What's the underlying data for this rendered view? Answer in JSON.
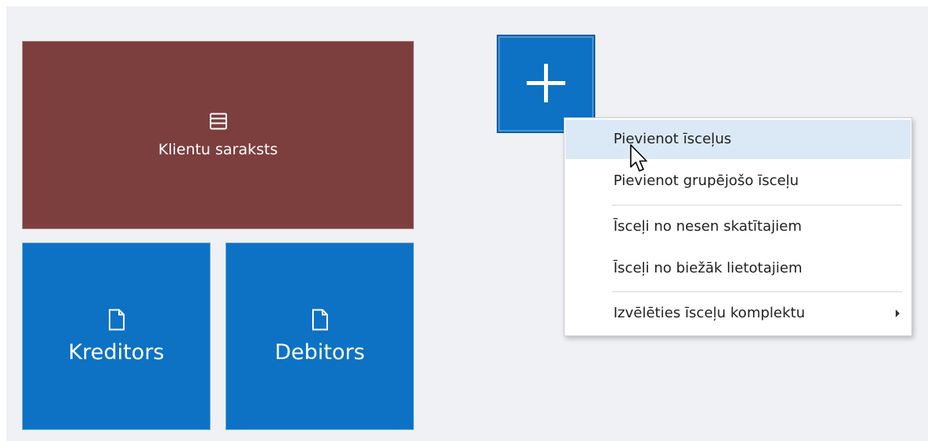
{
  "tiles": {
    "clients": {
      "label": "Klientu saraksts",
      "icon": "archive-box-icon"
    },
    "creditors": {
      "label": "Kreditors",
      "icon": "document-icon"
    },
    "debtors": {
      "label": "Debitors",
      "icon": "document-icon"
    },
    "add": {
      "icon": "plus-icon"
    }
  },
  "colors": {
    "background": "#eff1f4",
    "clients_tile": "#7d3e3e",
    "blue_tile": "#0d72c4",
    "menu_highlight": "#dbe9f6"
  },
  "context_menu": {
    "items": [
      {
        "label": "Pievienot īsceļus",
        "highlighted": true
      },
      {
        "label": "Pievienot grupējošo īsceļu",
        "highlighted": false
      },
      {
        "label": "Īsceļi no nesen skatītajiem",
        "highlighted": false
      },
      {
        "label": "Īsceļi no biežāk lietotajiem",
        "highlighted": false
      },
      {
        "label": "Izvēlēties īsceļu komplektu",
        "highlighted": false,
        "has_submenu": true
      }
    ]
  }
}
